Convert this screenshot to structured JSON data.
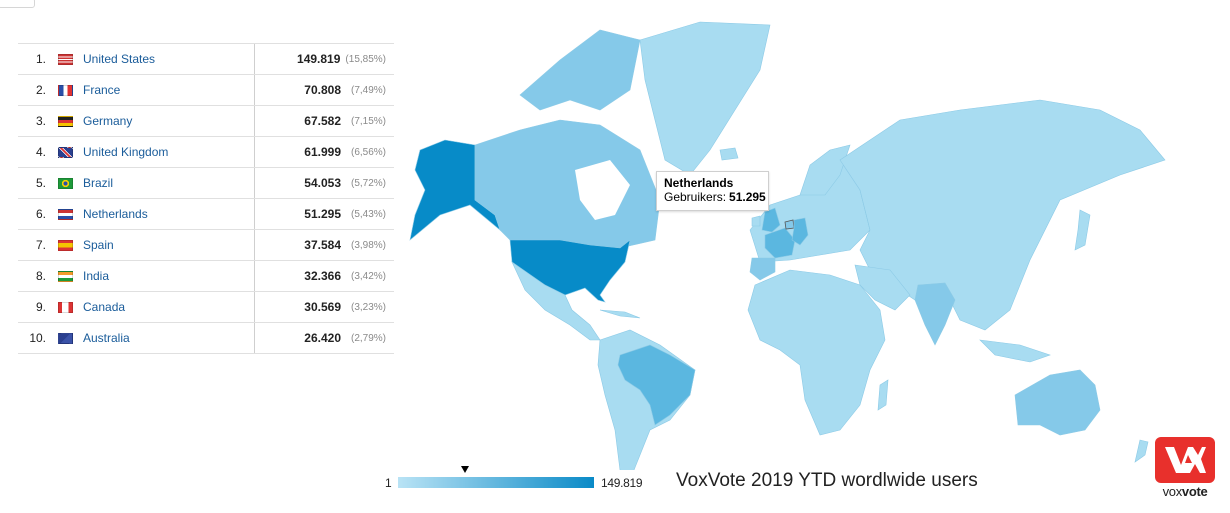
{
  "table": {
    "rows": [
      {
        "rank": "1.",
        "country": "United States",
        "value": "149.819",
        "percent": "(15,85%)",
        "flag": "us-flag"
      },
      {
        "rank": "2.",
        "country": "France",
        "value": "70.808",
        "percent": "(7,49%)",
        "flag": "fr-flag"
      },
      {
        "rank": "3.",
        "country": "Germany",
        "value": "67.582",
        "percent": "(7,15%)",
        "flag": "de-flag"
      },
      {
        "rank": "4.",
        "country": "United Kingdom",
        "value": "61.999",
        "percent": "(6,56%)",
        "flag": "gb-flag"
      },
      {
        "rank": "5.",
        "country": "Brazil",
        "value": "54.053",
        "percent": "(5,72%)",
        "flag": "br-flag"
      },
      {
        "rank": "6.",
        "country": "Netherlands",
        "value": "51.295",
        "percent": "(5,43%)",
        "flag": "nl-flag"
      },
      {
        "rank": "7.",
        "country": "Spain",
        "value": "37.584",
        "percent": "(3,98%)",
        "flag": "es-flag"
      },
      {
        "rank": "8.",
        "country": "India",
        "value": "32.366",
        "percent": "(3,42%)",
        "flag": "in-flag"
      },
      {
        "rank": "9.",
        "country": "Canada",
        "value": "30.569",
        "percent": "(3,23%)",
        "flag": "ca-flag"
      },
      {
        "rank": "10.",
        "country": "Australia",
        "value": "26.420",
        "percent": "(2,79%)",
        "flag": "au-flag"
      }
    ]
  },
  "tooltip": {
    "title": "Netherlands",
    "label": "Gebruikers:",
    "value": "51.295"
  },
  "legend": {
    "min": "1",
    "max": "149.819",
    "marker_value": 51295,
    "color_min": "#b9e3f5",
    "color_max": "#0a8ac7"
  },
  "caption": "VoxVote 2019 YTD wordlwide users",
  "logo": {
    "brand_light": "vox",
    "brand_bold": "vote",
    "color": "#e8302c"
  },
  "colors": {
    "base_land": "#a8dcf1",
    "united_states": "#078bc8",
    "brazil_france_germany_uk": "#5bb7e0",
    "netherlands_spain_india_canada": "#85c9e9",
    "border": "#7fc1df"
  }
}
